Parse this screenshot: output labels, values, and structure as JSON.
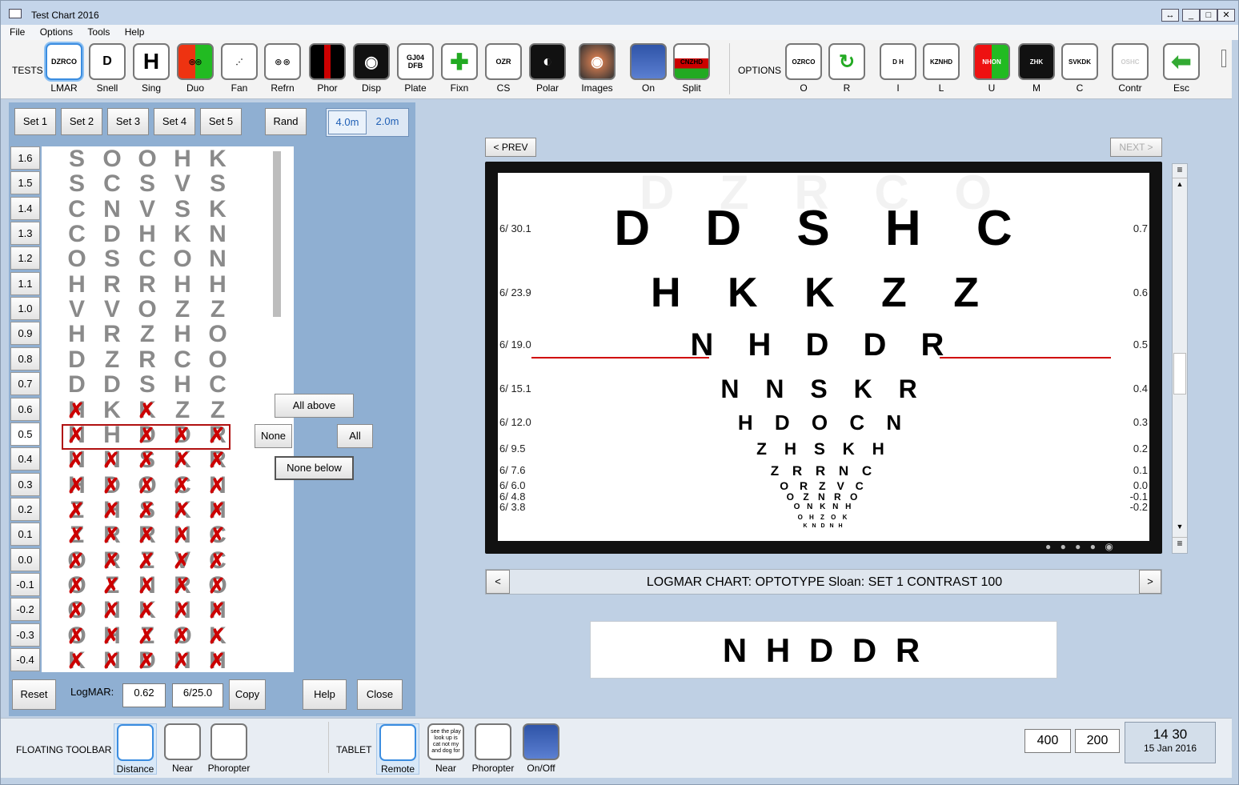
{
  "window": {
    "title": "Test Chart 2016",
    "buttons": [
      "↔",
      "_",
      "□",
      "✕"
    ]
  },
  "menu": [
    "File",
    "Options",
    "Tools",
    "Help"
  ],
  "toolbar": {
    "tests_label": "TESTS",
    "options_label": "OPTIONS",
    "tests": [
      {
        "label": "LMAR",
        "icon": "logmar-chart-icon",
        "glyph": "DZRCO"
      },
      {
        "label": "Snell",
        "icon": "snellen-chart-icon",
        "glyph": "D"
      },
      {
        "label": "Sing",
        "icon": "single-letter-icon",
        "glyph": "H"
      },
      {
        "label": "Duo",
        "icon": "duochrome-icon",
        "glyph": "◎◎"
      },
      {
        "label": "Fan",
        "icon": "fan-chart-icon",
        "glyph": "⋰"
      },
      {
        "label": "Refrn",
        "icon": "refraction-icon",
        "glyph": "◎ ◎"
      },
      {
        "label": "Phor",
        "icon": "phoria-icon",
        "glyph": ""
      },
      {
        "label": "Disp",
        "icon": "disparity-icon",
        "glyph": "◉"
      },
      {
        "label": "Plate",
        "icon": "plate-icon",
        "glyph": "GJ04 DFB"
      },
      {
        "label": "Fixn",
        "icon": "fixation-cross-icon",
        "glyph": "✚"
      },
      {
        "label": "CS",
        "icon": "contrast-sensitivity-icon",
        "glyph": "OZR"
      },
      {
        "label": "Polar",
        "icon": "polar-icon",
        "glyph": "◐"
      },
      {
        "label": "Images",
        "icon": "eye-images-icon",
        "glyph": "◉"
      },
      {
        "label": "On",
        "icon": "screen-on-icon",
        "glyph": ""
      },
      {
        "label": "Split",
        "icon": "split-icon",
        "glyph": "CNZHD"
      }
    ],
    "options": [
      {
        "label": "O",
        "icon": "optotype-icon",
        "glyph": "OZRCO"
      },
      {
        "label": "R",
        "icon": "randomize-icon",
        "glyph": "↻"
      },
      {
        "label": "I",
        "icon": "vertical-line-icon",
        "glyph": "D H"
      },
      {
        "label": "L",
        "icon": "single-line-icon",
        "glyph": "KZNHD"
      },
      {
        "label": "U",
        "icon": "red-green-icon",
        "glyph": "NHON"
      },
      {
        "label": "M",
        "icon": "mirror-icon",
        "glyph": "ZHK"
      },
      {
        "label": "C",
        "icon": "crowding-icon",
        "glyph": "SVKDK"
      },
      {
        "label": "Contr",
        "icon": "contrast-icon",
        "glyph": "OSHC"
      },
      {
        "label": "Esc",
        "icon": "escape-arrow-icon",
        "glyph": "⬅"
      }
    ]
  },
  "left": {
    "sets": [
      "Set 1",
      "Set 2",
      "Set 3",
      "Set 4",
      "Set 5"
    ],
    "rand": "Rand",
    "distances": [
      "4.0m",
      "2.0m"
    ],
    "rows": [
      {
        "label": "1.6",
        "letters": [
          "S",
          "O",
          "O",
          "H",
          "K"
        ],
        "x": [
          0,
          0,
          0,
          0,
          0
        ]
      },
      {
        "label": "1.5",
        "letters": [
          "S",
          "C",
          "S",
          "V",
          "S"
        ],
        "x": [
          0,
          0,
          0,
          0,
          0
        ]
      },
      {
        "label": "1.4",
        "letters": [
          "C",
          "N",
          "V",
          "S",
          "K"
        ],
        "x": [
          0,
          0,
          0,
          0,
          0
        ]
      },
      {
        "label": "1.3",
        "letters": [
          "C",
          "D",
          "H",
          "K",
          "N"
        ],
        "x": [
          0,
          0,
          0,
          0,
          0
        ]
      },
      {
        "label": "1.2",
        "letters": [
          "O",
          "S",
          "C",
          "O",
          "N"
        ],
        "x": [
          0,
          0,
          0,
          0,
          0
        ]
      },
      {
        "label": "1.1",
        "letters": [
          "H",
          "R",
          "R",
          "H",
          "H"
        ],
        "x": [
          0,
          0,
          0,
          0,
          0
        ]
      },
      {
        "label": "1.0",
        "letters": [
          "V",
          "V",
          "O",
          "Z",
          "Z"
        ],
        "x": [
          0,
          0,
          0,
          0,
          0
        ]
      },
      {
        "label": "0.9",
        "letters": [
          "H",
          "R",
          "Z",
          "H",
          "O"
        ],
        "x": [
          0,
          0,
          0,
          0,
          0
        ]
      },
      {
        "label": "0.8",
        "letters": [
          "D",
          "Z",
          "R",
          "C",
          "O"
        ],
        "x": [
          0,
          0,
          0,
          0,
          0
        ]
      },
      {
        "label": "0.7",
        "letters": [
          "D",
          "D",
          "S",
          "H",
          "C"
        ],
        "x": [
          0,
          0,
          0,
          0,
          0
        ]
      },
      {
        "label": "0.6",
        "letters": [
          "H",
          "K",
          "K",
          "Z",
          "Z"
        ],
        "x": [
          1,
          0,
          1,
          0,
          0
        ]
      },
      {
        "label": "0.5",
        "letters": [
          "N",
          "H",
          "D",
          "D",
          "R"
        ],
        "x": [
          1,
          0,
          1,
          1,
          1
        ]
      },
      {
        "label": "0.4",
        "letters": [
          "N",
          "N",
          "S",
          "K",
          "R"
        ],
        "x": [
          1,
          1,
          1,
          1,
          1
        ]
      },
      {
        "label": "0.3",
        "letters": [
          "H",
          "D",
          "O",
          "C",
          "N"
        ],
        "x": [
          1,
          1,
          1,
          1,
          1
        ]
      },
      {
        "label": "0.2",
        "letters": [
          "Z",
          "H",
          "S",
          "K",
          "H"
        ],
        "x": [
          1,
          1,
          1,
          1,
          1
        ]
      },
      {
        "label": "0.1",
        "letters": [
          "Z",
          "R",
          "R",
          "N",
          "C"
        ],
        "x": [
          1,
          1,
          1,
          1,
          1
        ]
      },
      {
        "label": "0.0",
        "letters": [
          "O",
          "R",
          "Z",
          "V",
          "C"
        ],
        "x": [
          1,
          1,
          1,
          1,
          1
        ]
      },
      {
        "label": "-0.1",
        "letters": [
          "O",
          "Z",
          "N",
          "R",
          "O"
        ],
        "x": [
          1,
          1,
          1,
          1,
          1
        ]
      },
      {
        "label": "-0.2",
        "letters": [
          "O",
          "N",
          "K",
          "N",
          "H"
        ],
        "x": [
          1,
          1,
          1,
          1,
          1
        ]
      },
      {
        "label": "-0.3",
        "letters": [
          "O",
          "H",
          "Z",
          "O",
          "K"
        ],
        "x": [
          1,
          1,
          1,
          1,
          1
        ]
      },
      {
        "label": "-0.4",
        "letters": [
          "K",
          "N",
          "D",
          "N",
          "H"
        ],
        "x": [
          1,
          1,
          1,
          1,
          1
        ]
      }
    ],
    "all_above": "All above",
    "none": "None",
    "all": "All",
    "none_below": "None below",
    "reset": "Reset",
    "logmar_label": "LogMAR:",
    "logmar_value": "0.62",
    "snellen_value": "6/25.0",
    "copy": "Copy",
    "help": "Help",
    "close": "Close"
  },
  "right": {
    "prev": "< PREV",
    "next": "NEXT >",
    "chart_rows": [
      {
        "snellen": "6/ 30.1",
        "logmar": "0.7",
        "letters": "D D S H C"
      },
      {
        "snellen": "6/ 23.9",
        "logmar": "0.6",
        "letters": "H K K Z Z"
      },
      {
        "snellen": "6/ 19.0",
        "logmar": "0.5",
        "letters": "N H D D R"
      },
      {
        "snellen": "6/ 15.1",
        "logmar": "0.4",
        "letters": "N N S K R"
      },
      {
        "snellen": "6/ 12.0",
        "logmar": "0.3",
        "letters": "H D O C N"
      },
      {
        "snellen": "6/ 9.5",
        "logmar": "0.2",
        "letters": "Z H S K H"
      },
      {
        "snellen": "6/ 7.6",
        "logmar": "0.1",
        "letters": "Z R R N C"
      },
      {
        "snellen": "6/ 6.0",
        "logmar": "0.0",
        "letters": "O R Z V C"
      },
      {
        "snellen": "6/ 4.8",
        "logmar": "-0.1",
        "letters": "O Z N R O"
      },
      {
        "snellen": "6/ 3.8",
        "logmar": "-0.2",
        "letters": "O N K N H"
      },
      {
        "snellen": "",
        "logmar": "",
        "letters": "O H Z O K"
      },
      {
        "snellen": "",
        "logmar": "",
        "letters": "K N D N H"
      }
    ],
    "faded_top_row": "D Z R C O",
    "status": "LOGMAR CHART:  OPTOTYPE Sloan:   SET 1  CONTRAST  100",
    "status_prev": "<",
    "status_next": ">",
    "current_line": "N H D D R"
  },
  "bottom": {
    "floating_label": "FLOATING TOOLBAR",
    "floating_tools": [
      {
        "label": "Distance",
        "icon": "distance-chart-icon"
      },
      {
        "label": "Near",
        "icon": "tablet-device-icon"
      },
      {
        "label": "Phoropter",
        "icon": "phoropter-icon"
      }
    ],
    "tablet_label": "TABLET",
    "tablet_tools": [
      {
        "label": "Remote",
        "icon": "remote-icon",
        "text": ""
      },
      {
        "label": "Near",
        "icon": "near-text-icon",
        "text": "see the play look up is cat not my and dog for"
      },
      {
        "label": "Phoropter",
        "icon": "phoropter-icon",
        "text": ""
      },
      {
        "label": "On/Off",
        "icon": "power-toggle-icon",
        "text": ""
      }
    ],
    "value1": "400",
    "value2": "200",
    "time": "14 30",
    "date": "15 Jan 2016"
  }
}
